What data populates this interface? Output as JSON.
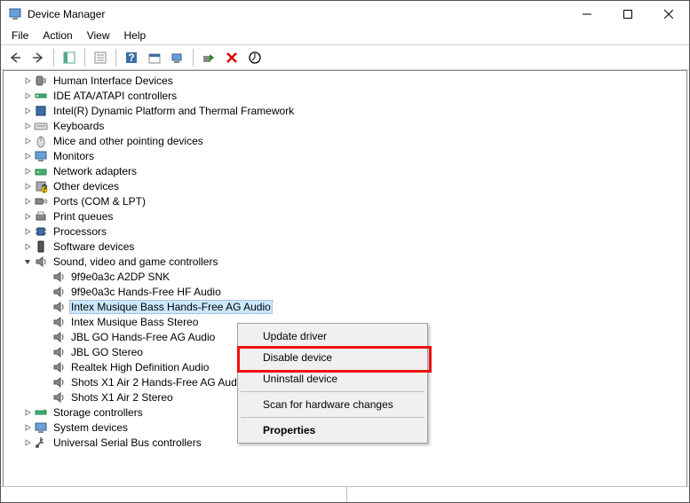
{
  "window": {
    "title": "Device Manager"
  },
  "menu": {
    "file": "File",
    "action": "Action",
    "view": "View",
    "help": "Help"
  },
  "tree": {
    "categories": [
      {
        "label": "Human Interface Devices"
      },
      {
        "label": "IDE ATA/ATAPI controllers"
      },
      {
        "label": "Intel(R) Dynamic Platform and Thermal Framework"
      },
      {
        "label": "Keyboards"
      },
      {
        "label": "Mice and other pointing devices"
      },
      {
        "label": "Monitors"
      },
      {
        "label": "Network adapters"
      },
      {
        "label": "Other devices"
      },
      {
        "label": "Ports (COM & LPT)"
      },
      {
        "label": "Print queues"
      },
      {
        "label": "Processors"
      },
      {
        "label": "Software devices"
      },
      {
        "label": "Sound, video and game controllers",
        "expanded": true,
        "children": [
          "9f9e0a3c A2DP SNK",
          "9f9e0a3c Hands-Free HF Audio",
          "Intex Musique Bass Hands-Free AG Audio",
          "Intex Musique Bass Stereo",
          "JBL GO Hands-Free AG Audio",
          "JBL GO Stereo",
          "Realtek High Definition Audio",
          "Shots X1 Air 2 Hands-Free AG Audio",
          "Shots X1 Air 2 Stereo"
        ],
        "selectedIndex": 2
      },
      {
        "label": "Storage controllers"
      },
      {
        "label": "System devices"
      },
      {
        "label": "Universal Serial Bus controllers"
      }
    ]
  },
  "context_menu": {
    "update": "Update driver",
    "disable": "Disable device",
    "uninstall": "Uninstall device",
    "scan": "Scan for hardware changes",
    "properties": "Properties"
  }
}
